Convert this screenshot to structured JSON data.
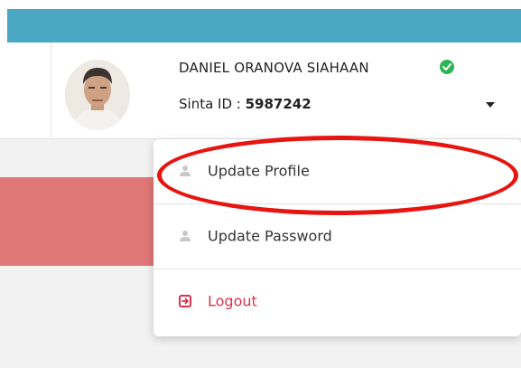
{
  "header": {
    "user_name": "DANIEL ORANOVA SIAHAAN",
    "sinta_label": "Sinta ID : ",
    "sinta_value": "5987242"
  },
  "menu": {
    "items": [
      {
        "label": "Update Profile",
        "icon": "user-icon"
      },
      {
        "label": "Update Password",
        "icon": "user-icon"
      },
      {
        "label": "Logout",
        "icon": "logout-icon"
      }
    ]
  },
  "colors": {
    "top_bar": "#4aa8c4",
    "verified": "#2ab653",
    "logout": "#d6324f",
    "annotation": "#e81410",
    "banner": "#e07777"
  }
}
